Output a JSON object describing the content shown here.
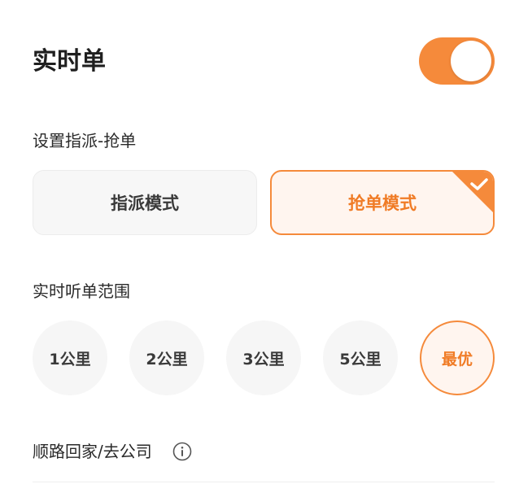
{
  "realtime": {
    "title": "实时单",
    "toggle_on": true
  },
  "dispatch": {
    "label": "设置指派-抢单",
    "options": [
      {
        "label": "指派模式",
        "selected": false
      },
      {
        "label": "抢单模式",
        "selected": true
      }
    ]
  },
  "range": {
    "label": "实时听单范围",
    "options": [
      {
        "label": "1公里",
        "selected": false
      },
      {
        "label": "2公里",
        "selected": false
      },
      {
        "label": "3公里",
        "selected": false
      },
      {
        "label": "5公里",
        "selected": false
      },
      {
        "label": "最优",
        "selected": true
      }
    ]
  },
  "route_home": {
    "label": "顺路回家/去公司",
    "icon": "info-icon"
  },
  "colors": {
    "accent": "#f58a3b",
    "accent_text": "#f07b25",
    "selected_bg": "#fff5ef",
    "unselected_bg": "#f6f6f6"
  }
}
